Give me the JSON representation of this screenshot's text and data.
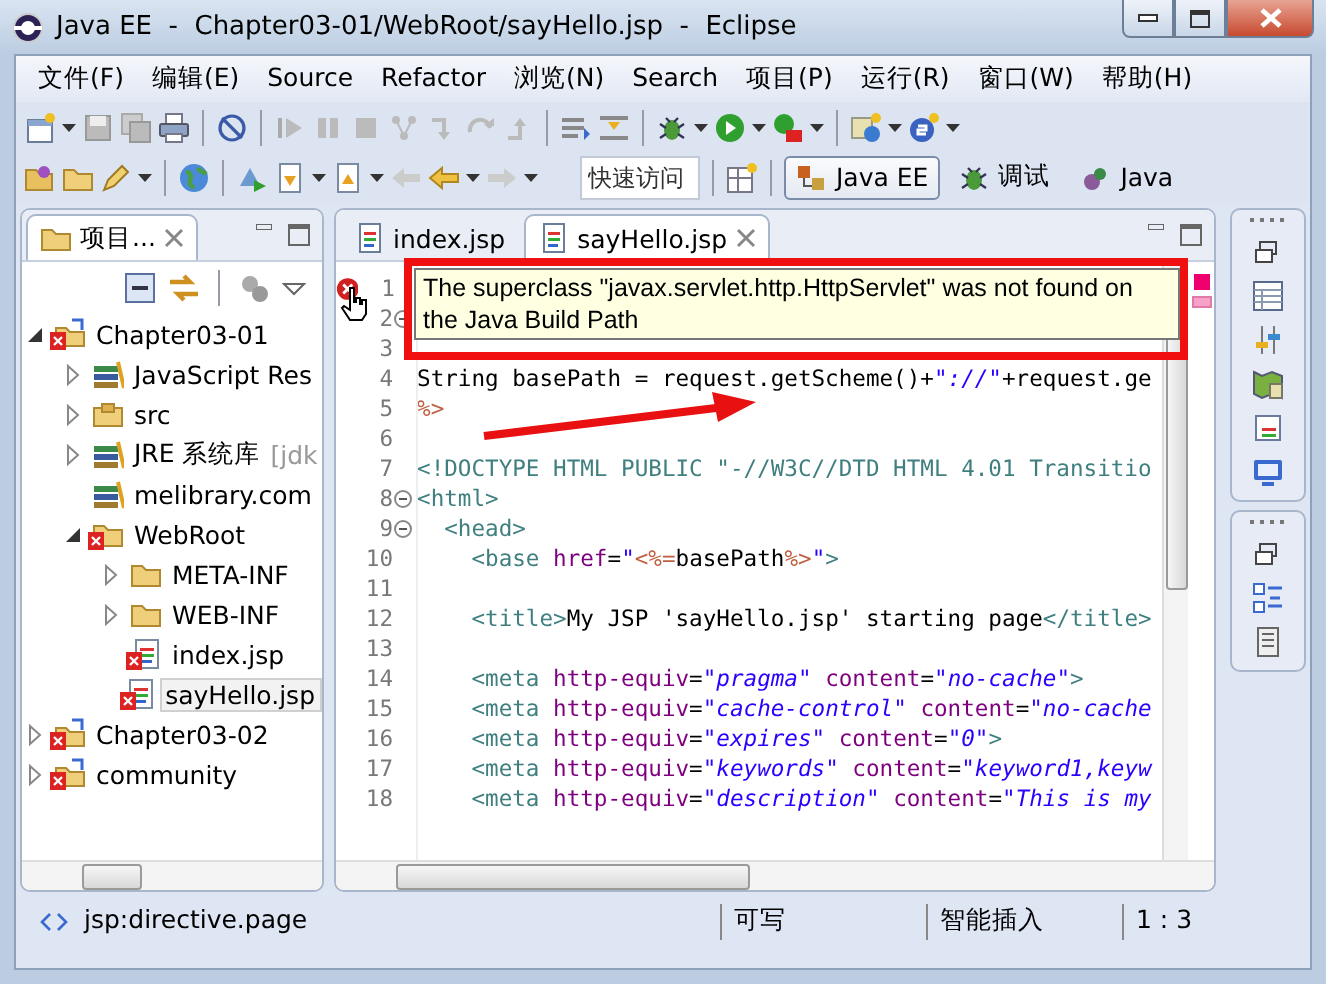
{
  "window": {
    "title": "Java EE  -  Chapter03-01/WebRoot/sayHello.jsp  -  Eclipse"
  },
  "menu": [
    "文件(F)",
    "编辑(E)",
    "Source",
    "Refactor",
    "浏览(N)",
    "Search",
    "项目(P)",
    "运行(R)",
    "窗口(W)",
    "帮助(H)"
  ],
  "quick_access": {
    "placeholder": "快速访问"
  },
  "perspectives": [
    {
      "label": "Java EE",
      "kind": "javaee",
      "selected": true
    },
    {
      "label": "调试",
      "kind": "debug",
      "selected": false
    },
    {
      "label": "Java",
      "kind": "java",
      "selected": false
    }
  ],
  "project_view": {
    "title": "项目...",
    "tree": [
      {
        "label": "Chapter03-01",
        "kind": "project",
        "error": true,
        "expanded": true,
        "selected": false,
        "children": [
          {
            "label": "JavaScript Res",
            "kind": "library",
            "error": false,
            "expanded": false,
            "selected": false
          },
          {
            "label": "src",
            "kind": "package",
            "error": false,
            "expanded": false,
            "selected": false
          },
          {
            "label": "JRE 系统库",
            "suffix": "[jdk",
            "kind": "library",
            "error": false,
            "expanded": false,
            "selected": false
          },
          {
            "label": "melibrary.com",
            "kind": "library",
            "error": false,
            "selected": false
          },
          {
            "label": "WebRoot",
            "kind": "folder",
            "error": true,
            "expanded": true,
            "selected": false,
            "children": [
              {
                "label": "META-INF",
                "kind": "folder",
                "error": false,
                "expanded": false,
                "selected": false
              },
              {
                "label": "WEB-INF",
                "kind": "folder",
                "error": false,
                "expanded": false,
                "selected": false
              },
              {
                "label": "index.jsp",
                "kind": "file",
                "error": true,
                "selected": false
              },
              {
                "label": "sayHello.jsp",
                "kind": "file",
                "error": true,
                "selected": true
              }
            ]
          }
        ]
      },
      {
        "label": "Chapter03-02",
        "kind": "project",
        "error": true,
        "expanded": false,
        "selected": false
      },
      {
        "label": "community",
        "kind": "project",
        "error": true,
        "expanded": false,
        "selected": false
      }
    ]
  },
  "editor": {
    "tabs": [
      {
        "label": "index.jsp",
        "selected": false
      },
      {
        "label": "sayHello.jsp",
        "selected": true
      }
    ],
    "lines": [
      {
        "number": "1",
        "error": true,
        "foldable": false
      },
      {
        "number": "2",
        "error": false,
        "foldable": true
      },
      {
        "number": "3",
        "error": false,
        "foldable": false
      },
      {
        "number": "4",
        "error": false,
        "foldable": false,
        "tokens": [
          {
            "kind": "plain",
            "text": "String basePath = request.getScheme()+"
          },
          {
            "kind": "str",
            "text": "\"://\""
          },
          {
            "kind": "plain",
            "text": "+request.ge"
          }
        ]
      },
      {
        "number": "5",
        "error": false,
        "foldable": false,
        "tokens": [
          {
            "kind": "jsp",
            "text": "%>"
          }
        ]
      },
      {
        "number": "6",
        "error": false,
        "foldable": false
      },
      {
        "number": "7",
        "error": false,
        "foldable": false,
        "tokens": [
          {
            "kind": "tag",
            "text": "<!DOCTYPE HTML PUBLIC \"-//W3C//DTD HTML 4.01 Transitio"
          }
        ]
      },
      {
        "number": "8",
        "error": false,
        "foldable": true,
        "tokens": [
          {
            "kind": "tag",
            "text": "<html>"
          }
        ]
      },
      {
        "number": "9",
        "error": false,
        "foldable": true,
        "tokens": [
          {
            "kind": "tag",
            "text": "  <head>"
          }
        ]
      },
      {
        "number": "10",
        "error": false,
        "foldable": false,
        "tokens": [
          {
            "kind": "tag",
            "text": "    <base "
          },
          {
            "kind": "attr",
            "text": "href"
          },
          {
            "kind": "plain",
            "text": "="
          },
          {
            "kind": "quote",
            "text": "\""
          },
          {
            "kind": "jsp",
            "text": "<%="
          },
          {
            "kind": "plain",
            "text": "basePath"
          },
          {
            "kind": "jsp",
            "text": "%>"
          },
          {
            "kind": "quote",
            "text": "\""
          },
          {
            "kind": "tag",
            "text": ">"
          }
        ]
      },
      {
        "number": "11",
        "error": false,
        "foldable": false
      },
      {
        "number": "12",
        "error": false,
        "foldable": false,
        "tokens": [
          {
            "kind": "tag",
            "text": "    <title>"
          },
          {
            "kind": "plain",
            "text": "My JSP 'sayHello.jsp' starting page"
          },
          {
            "kind": "tag",
            "text": "</title>"
          }
        ]
      },
      {
        "number": "13",
        "error": false,
        "foldable": false
      },
      {
        "number": "14",
        "error": false,
        "foldable": false,
        "tokens": [
          {
            "kind": "tag",
            "text": "    <meta "
          },
          {
            "kind": "attr",
            "text": "http-equiv"
          },
          {
            "kind": "plain",
            "text": "="
          },
          {
            "kind": "str",
            "text": "\"pragma\""
          },
          {
            "kind": "attr",
            "text": " content"
          },
          {
            "kind": "plain",
            "text": "="
          },
          {
            "kind": "str",
            "text": "\"no-cache\""
          },
          {
            "kind": "tag",
            "text": ">"
          }
        ]
      },
      {
        "number": "15",
        "error": false,
        "foldable": false,
        "tokens": [
          {
            "kind": "tag",
            "text": "    <meta "
          },
          {
            "kind": "attr",
            "text": "http-equiv"
          },
          {
            "kind": "plain",
            "text": "="
          },
          {
            "kind": "str",
            "text": "\"cache-control\""
          },
          {
            "kind": "attr",
            "text": " content"
          },
          {
            "kind": "plain",
            "text": "="
          },
          {
            "kind": "str",
            "text": "\"no-cache"
          }
        ]
      },
      {
        "number": "16",
        "error": false,
        "foldable": false,
        "tokens": [
          {
            "kind": "tag",
            "text": "    <meta "
          },
          {
            "kind": "attr",
            "text": "http-equiv"
          },
          {
            "kind": "plain",
            "text": "="
          },
          {
            "kind": "str",
            "text": "\"expires\""
          },
          {
            "kind": "attr",
            "text": " content"
          },
          {
            "kind": "plain",
            "text": "="
          },
          {
            "kind": "str",
            "text": "\"0\""
          },
          {
            "kind": "tag",
            "text": ">"
          }
        ]
      },
      {
        "number": "17",
        "error": false,
        "foldable": false,
        "tokens": [
          {
            "kind": "tag",
            "text": "    <meta "
          },
          {
            "kind": "attr",
            "text": "http-equiv"
          },
          {
            "kind": "plain",
            "text": "="
          },
          {
            "kind": "str",
            "text": "\"keywords\""
          },
          {
            "kind": "attr",
            "text": " content"
          },
          {
            "kind": "plain",
            "text": "="
          },
          {
            "kind": "str",
            "text": "\"keyword1,keyw"
          }
        ]
      },
      {
        "number": "18",
        "error": false,
        "foldable": false,
        "tokens": [
          {
            "kind": "tag",
            "text": "    <meta "
          },
          {
            "kind": "attr",
            "text": "http-equiv"
          },
          {
            "kind": "plain",
            "text": "="
          },
          {
            "kind": "str",
            "text": "\"description\""
          },
          {
            "kind": "attr",
            "text": " content"
          },
          {
            "kind": "plain",
            "text": "="
          },
          {
            "kind": "str",
            "text": "\"This is my"
          }
        ]
      }
    ],
    "tooltip": "The superclass \"javax.servlet.http.HttpServlet\" was not found on the Java Build Path"
  },
  "status_bar": {
    "element": "jsp:directive.page",
    "mode": "可写",
    "insert": "智能插入",
    "position": "1 : 3"
  }
}
